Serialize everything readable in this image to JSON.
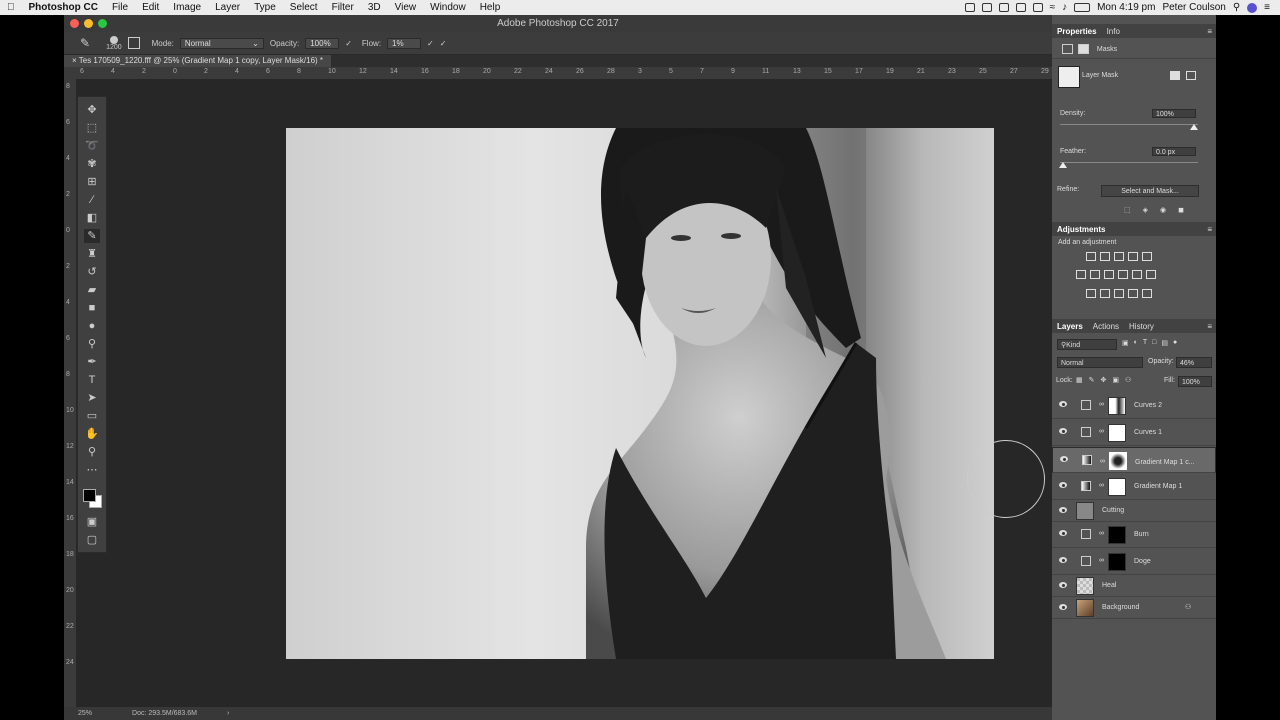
{
  "menubar": {
    "app": "Photoshop CC",
    "items": [
      "File",
      "Edit",
      "Image",
      "Layer",
      "Type",
      "Select",
      "Filter",
      "3D",
      "View",
      "Window",
      "Help"
    ],
    "clock": "Mon 4:19 pm",
    "user": "Peter Coulson"
  },
  "window": {
    "title": "Adobe Photoshop CC 2017"
  },
  "options": {
    "brush_size": "1200",
    "mode_label": "Mode:",
    "mode_value": "Normal",
    "opacity_label": "Opacity:",
    "opacity_value": "100%",
    "flow_label": "Flow:",
    "flow_value": "1%"
  },
  "document": {
    "tab": "Tes 170509_1220.fff @ 25% (Gradient Map 1 copy, Layer Mask/16) *",
    "zoom": "25%",
    "doc_info": "Doc: 293.5M/683.6M"
  },
  "ruler_h": [
    "6",
    "4",
    "2",
    "0",
    "2",
    "4",
    "6",
    "8",
    "10",
    "12",
    "14",
    "16",
    "18",
    "20",
    "22",
    "24",
    "26",
    "28",
    "3",
    "5",
    "7",
    "9",
    "11",
    "13",
    "15",
    "17",
    "19",
    "21",
    "23",
    "25",
    "27",
    "29"
  ],
  "ruler_v": [
    "8",
    "6",
    "4",
    "2",
    "0",
    "2",
    "4",
    "6",
    "8",
    "10",
    "12",
    "14",
    "16",
    "18",
    "20",
    "22",
    "24"
  ],
  "properties": {
    "tabs": [
      "Properties",
      "Info"
    ],
    "section": "Masks",
    "layer_mask": "Layer Mask",
    "density_label": "Density:",
    "density_value": "100%",
    "feather_label": "Feather:",
    "feather_value": "0.0 px",
    "refine_label": "Refine:",
    "refine_button": "Select and Mask..."
  },
  "adjustments": {
    "title": "Adjustments",
    "subtitle": "Add an adjustment"
  },
  "layers": {
    "tabs": [
      "Layers",
      "Actions",
      "History"
    ],
    "filter": "Kind",
    "blend_mode": "Normal",
    "opacity_label": "Opacity:",
    "opacity_value": "46%",
    "lock_label": "Lock:",
    "fill_label": "Fill:",
    "fill_value": "100%",
    "items": [
      {
        "name": "Curves 2"
      },
      {
        "name": "Curves 1"
      },
      {
        "name": "Gradient Map 1 c..."
      },
      {
        "name": "Gradient Map 1"
      },
      {
        "name": "Cutting"
      },
      {
        "name": "Burn"
      },
      {
        "name": "Doge"
      },
      {
        "name": "Heal"
      },
      {
        "name": "Background"
      }
    ]
  },
  "colors": {
    "panel_bg": "#535353",
    "canvas_bg": "#272727",
    "selected_layer": "#696969"
  }
}
